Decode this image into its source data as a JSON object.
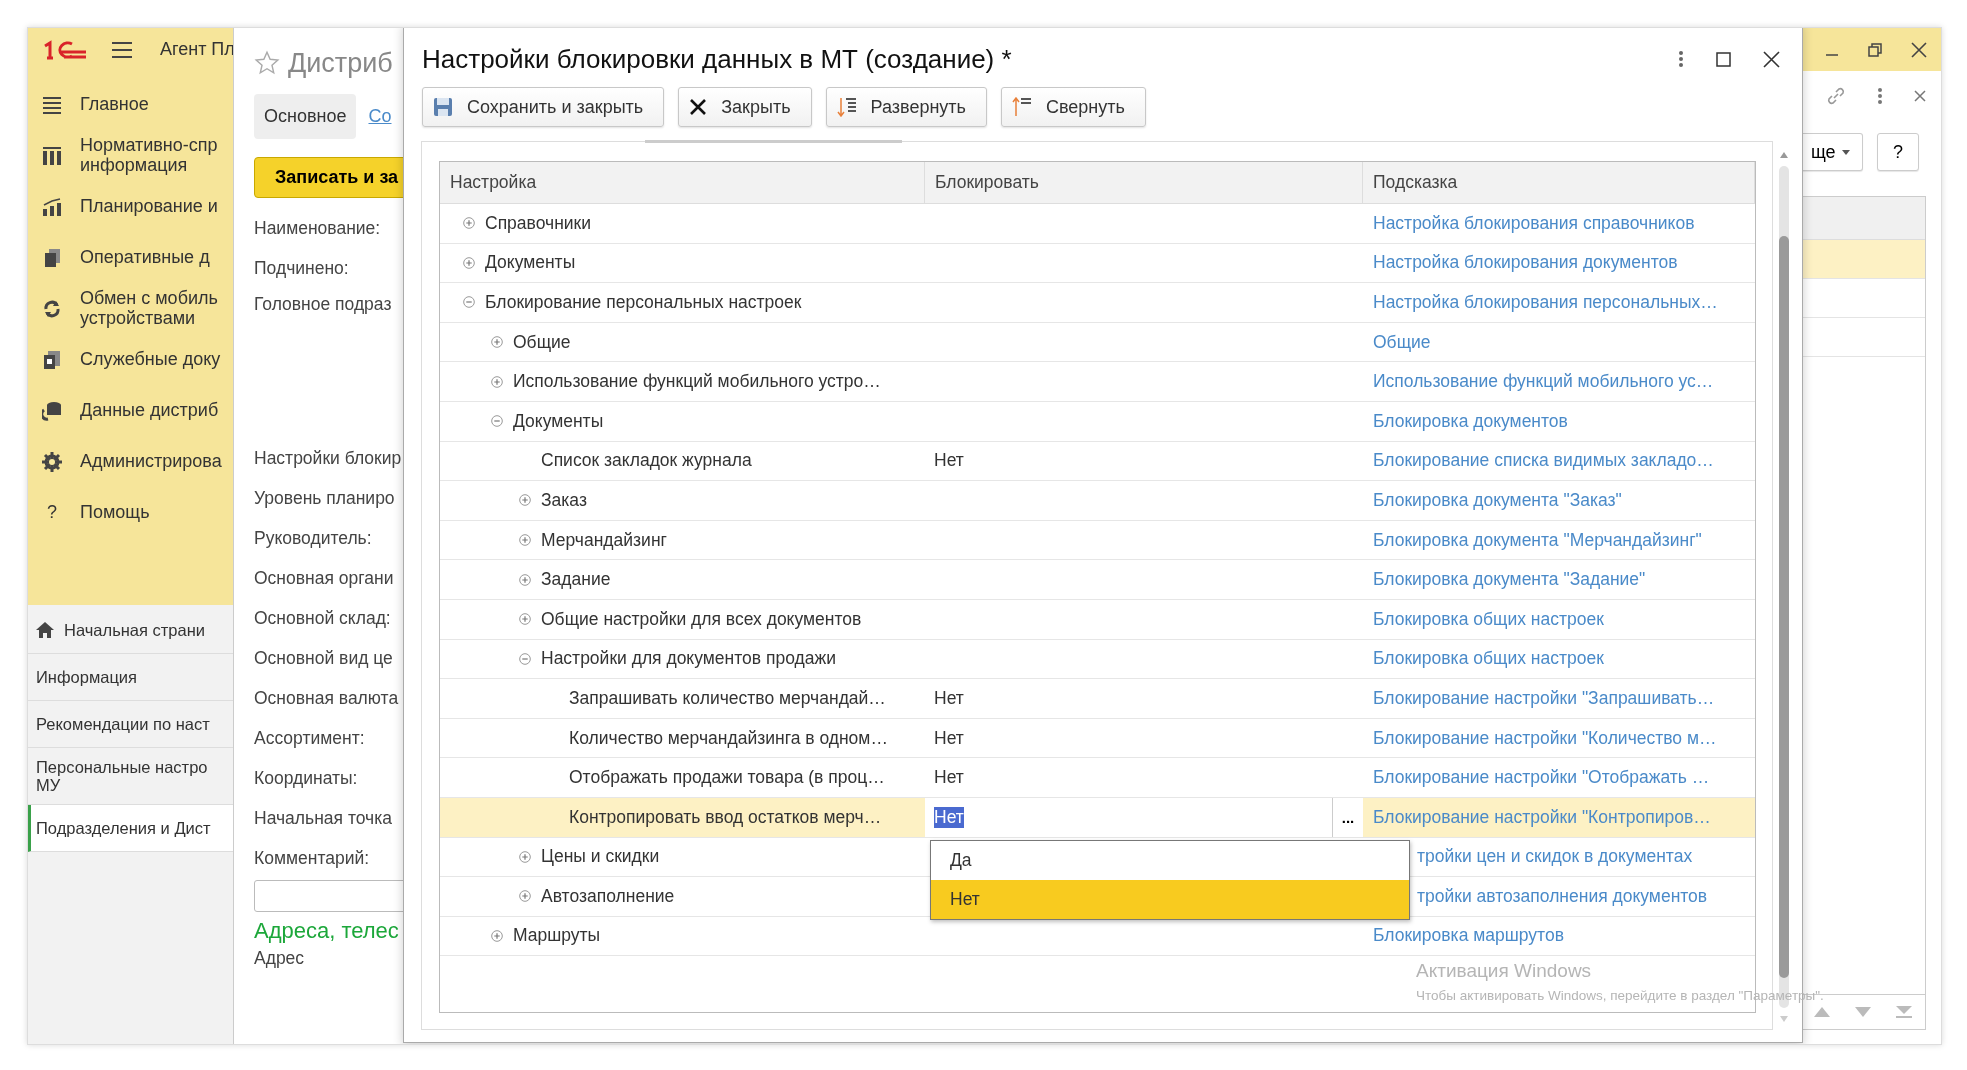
{
  "app": {
    "title": "Агент Пл"
  },
  "sidebar": {
    "menu": [
      {
        "label": "Главное"
      },
      {
        "label": "Нормативно-спр\nинформация"
      },
      {
        "label": "Планирование и"
      },
      {
        "label": "Оперативные д"
      },
      {
        "label": "Обмен с мобиль\nустройствами"
      },
      {
        "label": "Служебные доку"
      },
      {
        "label": "Данные дистриб"
      },
      {
        "label": "Администрирова"
      },
      {
        "label": "Помощь",
        "glyph": "?"
      }
    ],
    "pages": [
      {
        "label": "Начальная страни",
        "selected": false
      },
      {
        "label": "Информация",
        "selected": false
      },
      {
        "label": "Рекомендации по наст",
        "selected": false
      },
      {
        "label": "Персональные настро\nМУ",
        "selected": false
      },
      {
        "label": "Подразделения и Дист",
        "selected": true
      }
    ]
  },
  "form": {
    "title": "Дистриб",
    "tabs": [
      {
        "label": "Основное",
        "selected": true
      },
      {
        "label": "Со",
        "selected": false
      }
    ],
    "button": "Записать и за",
    "fields": [
      {
        "label": "Наименование:",
        "kind": "line"
      },
      {
        "label": "Подчинено:",
        "kind": "line"
      },
      {
        "label": "Головное подраз",
        "kind": "tall"
      },
      {
        "label": "Настройки блокир",
        "kind": "line"
      },
      {
        "label": "Уровень планиро",
        "kind": "line"
      },
      {
        "label": "Руководитель:",
        "kind": "line"
      },
      {
        "label": "Основная органи",
        "kind": "line"
      },
      {
        "label": "Основной склад:",
        "kind": "line"
      },
      {
        "label": "Основной вид це",
        "kind": "line"
      },
      {
        "label": "Основная валюта",
        "kind": "line"
      },
      {
        "label": "Ассортимент:",
        "kind": "line"
      },
      {
        "label": "Координаты:",
        "kind": "line"
      },
      {
        "label": "Начальная точка",
        "kind": "line"
      },
      {
        "label": "Комментарий:",
        "kind": "input"
      }
    ],
    "section": "Адреса, телес",
    "last_label": "Адрес"
  },
  "dialog": {
    "title": "Настройки блокировки данных в МТ (создание) *",
    "buttons": [
      {
        "label": "Сохранить и закрыть"
      },
      {
        "label": "Закрыть"
      },
      {
        "label": "Развернуть"
      },
      {
        "label": "Свернуть"
      }
    ],
    "table": {
      "columns": [
        "Настройка",
        "Блокировать",
        "Подсказка"
      ],
      "rows": [
        {
          "name": "Справочники",
          "expanded": false,
          "hint": "Настройка блокирования справочников"
        },
        {
          "name": "Документы",
          "expanded": false,
          "hint": "Настройка блокирования документов"
        },
        {
          "name": "Блокирование персональных настроек",
          "expanded": true,
          "hint": "Настройка блокирования персональных…",
          "children": [
            {
              "name": "Общие",
              "expanded": false,
              "hint": "Общие"
            },
            {
              "name": "Использование функций мобильного устро…",
              "expanded": false,
              "hint": "Использование функций мобильного ус…"
            },
            {
              "name": "Документы",
              "expanded": true,
              "hint": "Блокировка документов",
              "children": [
                {
                  "name": "Список закладок журнала",
                  "block": "Нет",
                  "hint": "Блокирование списка видимых закладо…"
                },
                {
                  "name": "Заказ",
                  "expanded": false,
                  "hint": "Блокировка документа \"Заказ\""
                },
                {
                  "name": "Мерчандайзинг",
                  "expanded": false,
                  "hint": "Блокировка документа \"Мерчандайзинг\""
                },
                {
                  "name": "Задание",
                  "expanded": false,
                  "hint": "Блокировка документа \"Задание\""
                },
                {
                  "name": "Общие настройки для всех документов",
                  "expanded": false,
                  "hint": "Блокировка общих настроек"
                },
                {
                  "name": "Настройки для документов продажи",
                  "expanded": true,
                  "hint": "Блокировка общих настроек",
                  "children": [
                    {
                      "name": "Запрашивать количество мерчандай…",
                      "block": "Нет",
                      "hint": "Блокирование настройки \"Запрашивать…",
                      "selected": false
                    },
                    {
                      "name": "Количество мерчандайзинга в одном…",
                      "block": "Нет",
                      "hint": "Блокирование настройки \"Количество м…",
                      "selected": false
                    },
                    {
                      "name": "Отображать продажи товара (в проц…",
                      "block": "Нет",
                      "hint": "Блокирование настройки \"Отображать …",
                      "selected": false
                    },
                    {
                      "name": "Контропировать ввод остатков мерч…",
                      "block": "Нет",
                      "hint": "Блокирование настройки \"Контропиров…",
                      "selected": true
                    }
                  ]
                },
                {
                  "name": "Цены и скидки",
                  "expanded": false,
                  "hint": "тройки цен и скидок в документах"
                },
                {
                  "name": "Автозаполнение",
                  "expanded": false,
                  "hint": "тройки автозаполнения документов"
                }
              ]
            },
            {
              "name": "Маршруты",
              "expanded": false,
              "hint": "Блокировка маршрутов"
            }
          ]
        }
      ]
    },
    "editor": {
      "button": "...",
      "options": [
        {
          "label": "Да",
          "selected": false
        },
        {
          "label": "Нет",
          "selected": true
        }
      ]
    }
  },
  "right_panel": {
    "more": "ще",
    "help": "?",
    "rows": [
      {
        "selected": true
      },
      {
        "selected": false
      },
      {
        "selected": false
      }
    ]
  },
  "os_notice": {
    "title": "Активация Windows",
    "text": "Чтобы активировать Windows, перейдите в раздел \"Параметры\"."
  }
}
